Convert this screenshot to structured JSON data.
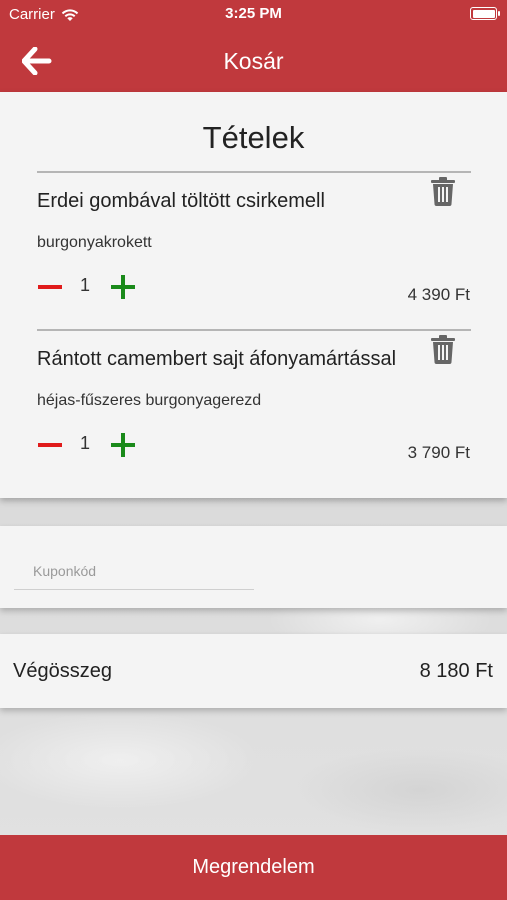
{
  "status_bar": {
    "carrier": "Carrier",
    "time": "3:25 PM"
  },
  "nav": {
    "title": "Kosár",
    "back_icon": "arrow-left-icon"
  },
  "items_section": {
    "title": "Tételek",
    "items": [
      {
        "name": "Erdei gombával töltött csirkemell",
        "side": "burgonyakrokett",
        "quantity": "1",
        "price": "4 390 Ft"
      },
      {
        "name": "Rántott camembert sajt áfonyamártással",
        "side": "héjas-fűszeres burgonyagerezd",
        "quantity": "1",
        "price": "3 790 Ft"
      }
    ]
  },
  "coupon": {
    "placeholder": "Kuponkód",
    "value": ""
  },
  "total": {
    "label": "Végösszeg",
    "value": "8 180 Ft"
  },
  "order_button": {
    "label": "Megrendelem"
  },
  "colors": {
    "brand": "#c0393d",
    "minus": "#e01b1b",
    "plus": "#1a8a1a"
  }
}
